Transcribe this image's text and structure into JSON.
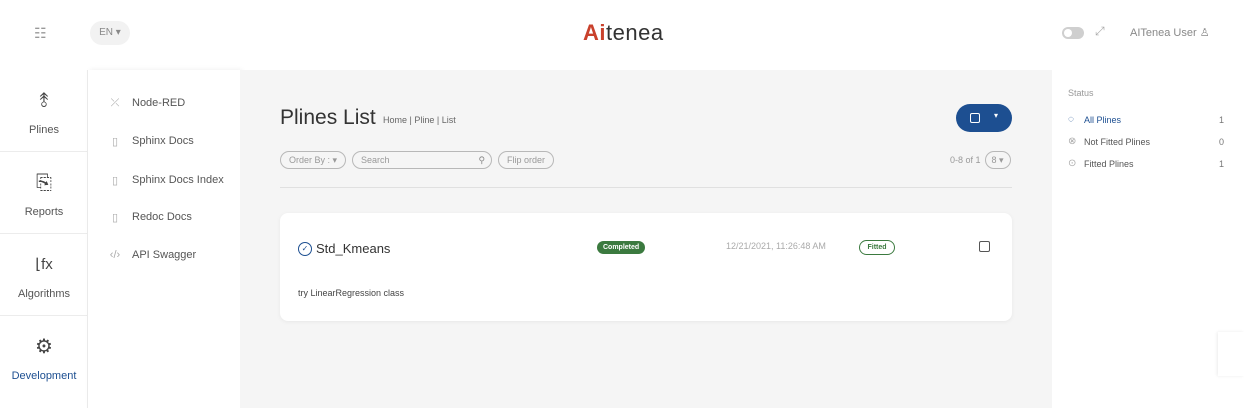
{
  "header": {
    "language": "EN ▾",
    "logo_prefix": "Ai",
    "logo_suffix": "tenea",
    "user_name": "AITenea User ♙"
  },
  "leftnav": {
    "items": [
      {
        "label": "Plines",
        "icon": "plines-icon"
      },
      {
        "label": "Reports",
        "icon": "reports-icon"
      },
      {
        "label": "Algorithms",
        "icon": "algorithms-icon"
      },
      {
        "label": "Development",
        "icon": "development-icon"
      }
    ],
    "active": "Development"
  },
  "subnav": {
    "items": [
      {
        "label": "Node-RED",
        "icon": "node-red-icon"
      },
      {
        "label": "Sphinx Docs",
        "icon": "document-icon"
      },
      {
        "label": "Sphinx Docs Index",
        "icon": "document-icon"
      },
      {
        "label": "Redoc Docs",
        "icon": "document-icon"
      },
      {
        "label": "API Swagger",
        "icon": "code-icon"
      }
    ]
  },
  "main": {
    "title": "Plines List",
    "breadcrumb": "Home | Pline | List",
    "filters": {
      "order_by": "Order By : ▾",
      "search_placeholder": "Search",
      "flip_order": "Flip order"
    },
    "pager": {
      "range": "0-8 of 1",
      "page_size": "8 ▾"
    },
    "cards": [
      {
        "name": "Std_Kmeans",
        "status": "Completed",
        "date": "12/21/2021, 11:26:48 AM",
        "fit_state": "Fitted",
        "description": "try LinearRegression class"
      }
    ]
  },
  "rightpanel": {
    "title": "Status",
    "items": [
      {
        "label": "All Plines",
        "count": "1",
        "icon": "all-icon",
        "active": true
      },
      {
        "label": "Not Fitted Plines",
        "count": "0",
        "icon": "x-circle-icon",
        "active": false
      },
      {
        "label": "Fitted Plines",
        "count": "1",
        "icon": "check-circle-icon",
        "active": false
      }
    ]
  },
  "colors": {
    "accent": "#1d4f91",
    "success": "#3b7a3f",
    "logo_red": "#c9412c"
  }
}
